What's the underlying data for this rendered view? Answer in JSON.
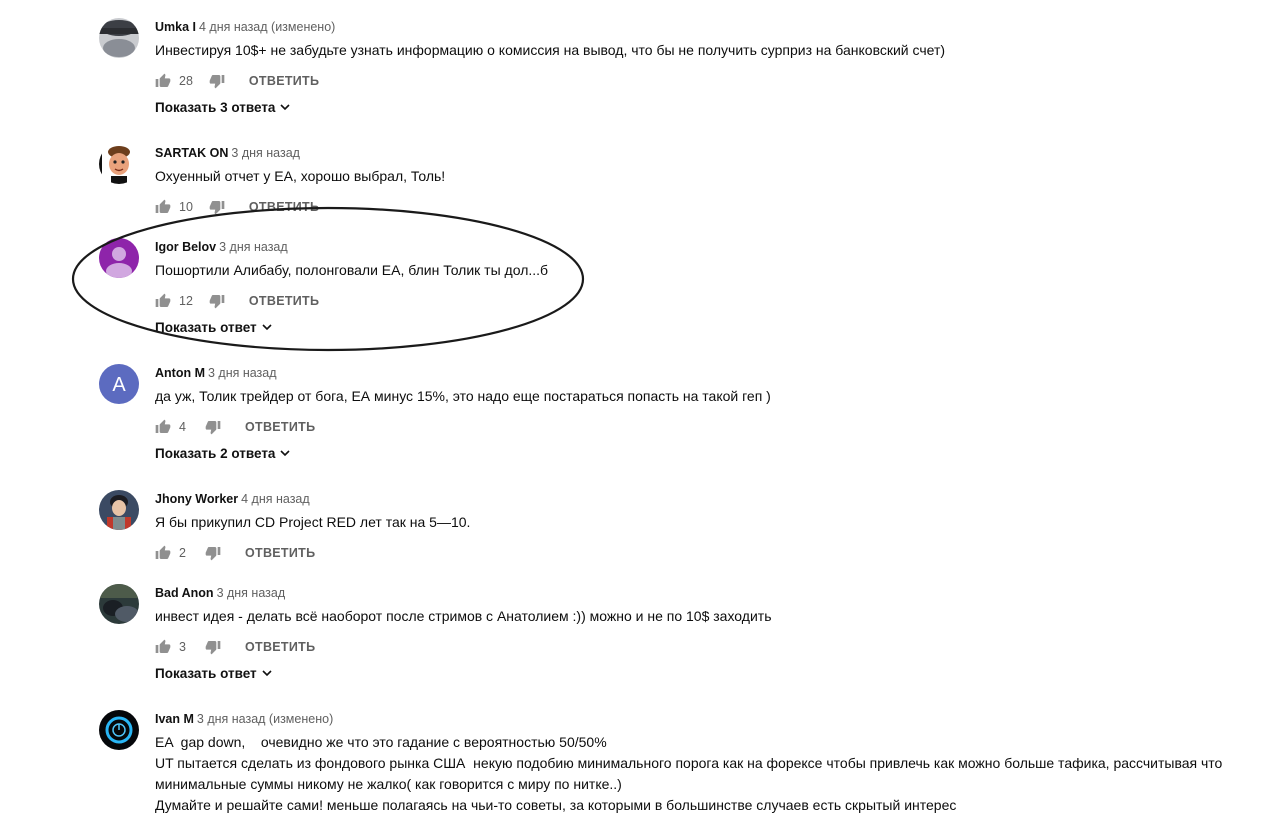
{
  "comments": [
    {
      "author": "Umka I",
      "time": "4 дня назад (изменено)",
      "lines": [
        "Инвестируя 10$+ не забудьте узнать информацию о комиссия на вывод, что бы не получить сурприз на банковский счет)"
      ],
      "likes": "28",
      "reply_label": "ОТВЕТИТЬ",
      "replies_label": "Показать 3 ответа",
      "avatar": "cat-photo"
    },
    {
      "author": "SARTAK ON",
      "time": "3 дня назад",
      "lines": [
        "Охуенный отчет у ЕА, хорошо выбрал, Толь!"
      ],
      "likes": "10",
      "reply_label": "ОТВЕТИТЬ",
      "avatar": "cartoon-face"
    },
    {
      "author": "Igor Belov",
      "time": "3 дня назад",
      "lines": [
        "Пошортили Алибабу, полонговали ЕА, блин Толик ты дол...б"
      ],
      "likes": "12",
      "reply_label": "ОТВЕТИТЬ",
      "replies_label": "Показать ответ",
      "avatar": "default-person",
      "avatar_color": "#8e24aa"
    },
    {
      "author": "Anton M",
      "time": "3 дня назад",
      "lines": [
        "да уж, Толик трейдер от бога, ЕА минус 15%, это надо еще постараться попасть на такой геп )"
      ],
      "likes": "4",
      "reply_label": "ОТВЕТИТЬ",
      "replies_label": "Показать 2 ответа",
      "avatar_letter": "A",
      "avatar_color": "#5c6bc0"
    },
    {
      "author": "Jhony Worker",
      "time": "4 дня назад",
      "lines": [
        "Я бы прикупил CD Project RED лет так на 5—10."
      ],
      "likes": "2",
      "reply_label": "ОТВЕТИТЬ",
      "avatar": "game-character"
    },
    {
      "author": "Bad Anon",
      "time": "3 дня назад",
      "lines": [
        "инвест идея - делать всё наоборот после стримов с Анатолием :)) можно и не по 10$ заходить"
      ],
      "likes": "3",
      "reply_label": "ОТВЕТИТЬ",
      "replies_label": "Показать ответ",
      "avatar": "dark-photo"
    },
    {
      "author": "Ivan M",
      "time": "3 дня назад (изменено)",
      "lines": [
        "EA  gap down,    очевидно же что это гадание с вероятностью 50/50%",
        "UT пытается сделать из фондового рынка США  некую подобию минимального порога как на форексе чтобы привлечь как можно больше тафика, рассчитывая что",
        "минимальные суммы никому не жалко( как говорится с миру по нитке..)",
        "Думайте и решайте сами! меньше полагаясь на чьи-то советы, за которыми в большинстве случаев есть скрытый интерес"
      ],
      "avatar": "power-icon"
    }
  ],
  "colors": {
    "secondary_text": "#606060",
    "ellipse_stroke": "#1a1a1a"
  }
}
